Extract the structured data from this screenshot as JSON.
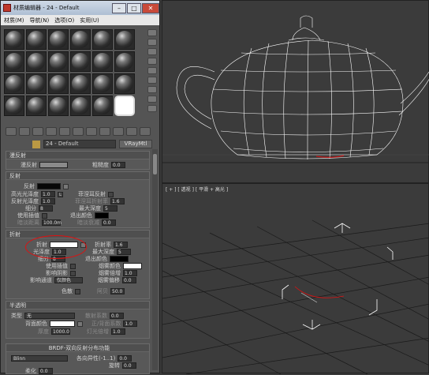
{
  "window": {
    "title": "材质编辑器 - 24 - Default"
  },
  "menu": [
    "材质(M)",
    "导航(N)",
    "选项(O)",
    "实用(U)"
  ],
  "material": {
    "name": "24 - Default",
    "type": "VRayMtl"
  },
  "basic": {
    "header": "漫反射",
    "diffuse": "漫反射",
    "roughness": "粗糙度",
    "roughness_val": "0.0",
    "diffuse_color": "#8a8a8a"
  },
  "reflect": {
    "header": "反射",
    "reflect": "反射",
    "hilight": "高光光泽度",
    "hilight_val": "1.0",
    "lock": "L",
    "reflect_gloss": "反射光泽度",
    "reflect_gloss_val": "1.0",
    "subdivs": "细分",
    "subdivs_val": "8",
    "use_interp": "使用插值",
    "dim_dist": "暗淡距离",
    "dim_dist_val": "100.0m",
    "fresnel": "菲涅耳反射",
    "fresnel_ior": "菲涅耳折射率",
    "fresnel_ior_val": "1.6",
    "max_depth": "最大深度",
    "max_depth_val": "5",
    "exit_color": "退出颜色",
    "dim_falloff": "暗淡衰减",
    "dim_falloff_val": "0.0",
    "reflect_color": "#080808"
  },
  "refract": {
    "header": "折射",
    "refract": "折射",
    "gloss": "光泽度",
    "gloss_val": "1.0",
    "subdivs": "细分",
    "subdivs_val": "8",
    "use_interp": "使用插值",
    "shadows": "影响阴影",
    "affect_ch": "影响通道",
    "affect_ch_val": "仅颜色",
    "dispersion": "色散",
    "ior": "折射率",
    "ior_val": "1.6",
    "max_depth": "最大深度",
    "max_depth_val": "5",
    "exit_color": "退出颜色",
    "fog_color": "烟雾颜色",
    "fog_mult": "烟雾倍增",
    "fog_mult_val": "1.0",
    "fog_bias": "烟雾偏移",
    "fog_bias_val": "0.0",
    "abbe": "阿贝",
    "abbe_val": "50.0",
    "refract_color": "#ffffff"
  },
  "translucency": {
    "header": "半透明",
    "type": "类型",
    "type_val": "无",
    "back_color": "背面颜色",
    "thickness": "厚度",
    "thickness_val": "1000.0",
    "scatter": "散射系数",
    "scatter_val": "0.0",
    "fwd_back": "正/背面系数",
    "fwd_back_val": "1.0",
    "light_mult": "灯光倍增",
    "light_mult_val": "1.0"
  },
  "brdf": {
    "header": "BRDF-双向反射分布功能",
    "type_val": "Blinn",
    "aniso": "各向异性(-1..1)",
    "aniso_val": "0.0",
    "rotation": "旋转",
    "rotation_val": "0.0",
    "soft": "柔化",
    "soft_val": "0.0"
  },
  "viewport": {
    "label": "[ + ] [ 透视 ] [ 平滑 + 高光 ]"
  },
  "colors": {
    "highlight": "#e01010",
    "wire": "#ffffff"
  }
}
